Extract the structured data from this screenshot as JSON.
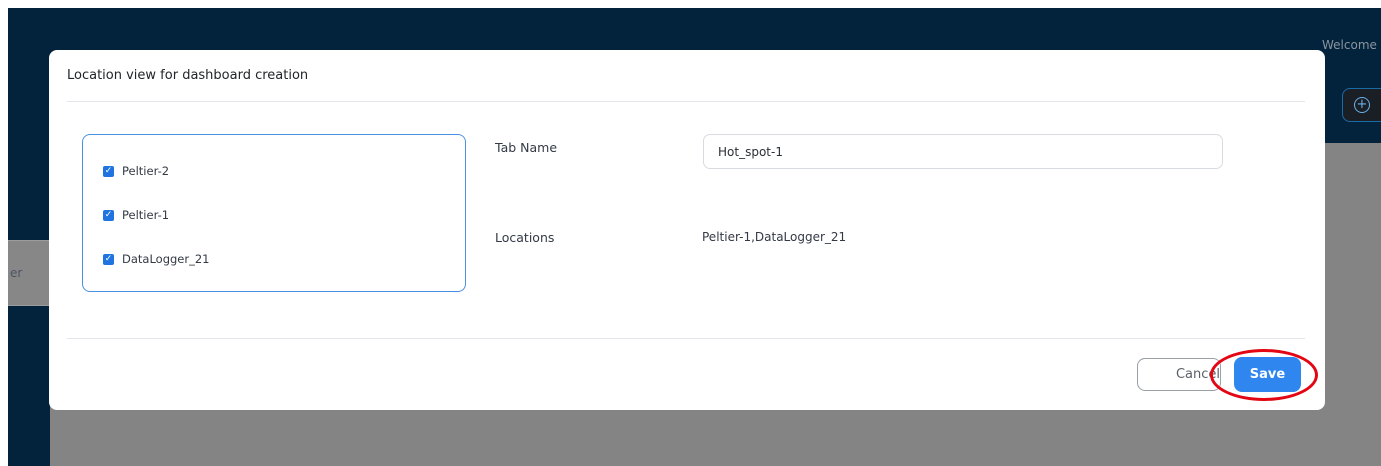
{
  "app": {
    "welcome_text": "Welcome",
    "left_tab_text": "er"
  },
  "modal": {
    "title": "Location view for dashboard creation",
    "locations_list": [
      {
        "label": "Peltier-2",
        "checked": true
      },
      {
        "label": "Peltier-1",
        "checked": true
      },
      {
        "label": "DataLogger_21",
        "checked": true
      }
    ],
    "tab_name_label": "Tab Name",
    "tab_name_value": "Hot_spot-1",
    "locations_label": "Locations",
    "locations_value": "Peltier-1,DataLogger_21",
    "cancel_label": "Cancel",
    "save_label": "Save"
  },
  "colors": {
    "header": "#03223b",
    "overlay": "#848484",
    "primary": "#2f86ef",
    "highlight": "#e30613"
  },
  "icons": {
    "add": "plus-circle-icon",
    "checkbox": "checkbox-checked-icon"
  }
}
